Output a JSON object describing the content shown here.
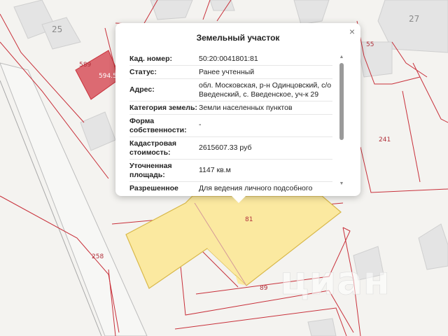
{
  "map": {
    "parcel_labels": [
      "589",
      "594.5",
      "55",
      "241",
      "81",
      "258",
      "89"
    ],
    "building_numbers": [
      "25",
      "27"
    ],
    "selected_parcel_color": "#fbe9a0",
    "boundary_color": "#c8303a",
    "highlight_parcel_color": "#dc6a72",
    "watermark": "циан"
  },
  "popup": {
    "title": "Земельный участок",
    "close_icon": "×",
    "rows": [
      {
        "key": "Кад. номер:",
        "value": "50:20:0041801:81"
      },
      {
        "key": "Статус:",
        "value": "Ранее учтенный"
      },
      {
        "key": "Адрес:",
        "value": "обл. Московская, р-н Одинцовский, с/о Введенский, с. Введенское, уч-к 29"
      },
      {
        "key": "Категория земель:",
        "value": "Земли населенных пунктов"
      },
      {
        "key": "Форма собственности:",
        "value": "-"
      },
      {
        "key": "Кадастровая стоимость:",
        "value": "2615607.33 руб"
      },
      {
        "key": "Уточненная площадь:",
        "value": "1147 кв.м"
      },
      {
        "key": "Разрешенное",
        "value": "Для ведения личного подсобного"
      }
    ]
  }
}
